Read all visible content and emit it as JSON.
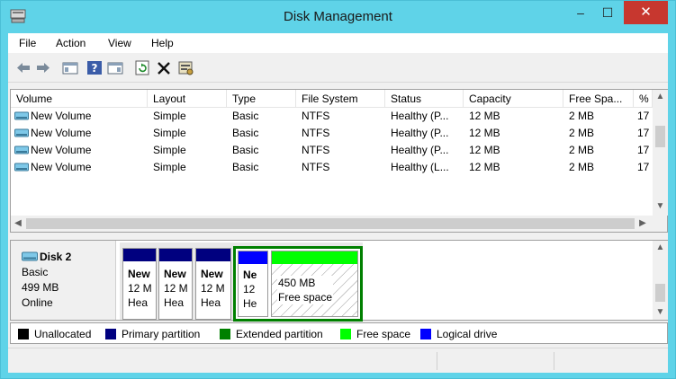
{
  "window": {
    "title": "Disk Management",
    "minimize_glyph": "–",
    "maximize_glyph": "☐",
    "close_glyph": "✕",
    "frame_color": "#5fd3e8",
    "close_color": "#c7372f"
  },
  "menu": {
    "items": [
      "File",
      "Action",
      "View",
      "Help"
    ]
  },
  "toolbar": {
    "icons": [
      "back-arrow-icon",
      "forward-arrow-icon",
      "show-hide-console-tree-icon",
      "help-icon",
      "show-hide-action-pane-icon",
      "refresh-icon",
      "delete-icon",
      "properties-icon"
    ]
  },
  "volume_list": {
    "columns": [
      "Volume",
      "Layout",
      "Type",
      "File System",
      "Status",
      "Capacity",
      "Free Spa...",
      "% "
    ],
    "rows": [
      {
        "volume": "New Volume",
        "layout": "Simple",
        "type": "Basic",
        "fs": "NTFS",
        "status": "Healthy (P...",
        "capacity": "12 MB",
        "free": "2 MB",
        "pct": "17"
      },
      {
        "volume": "New Volume",
        "layout": "Simple",
        "type": "Basic",
        "fs": "NTFS",
        "status": "Healthy (P...",
        "capacity": "12 MB",
        "free": "2 MB",
        "pct": "17"
      },
      {
        "volume": "New Volume",
        "layout": "Simple",
        "type": "Basic",
        "fs": "NTFS",
        "status": "Healthy (P...",
        "capacity": "12 MB",
        "free": "2 MB",
        "pct": "17"
      },
      {
        "volume": "New Volume",
        "layout": "Simple",
        "type": "Basic",
        "fs": "NTFS",
        "status": "Healthy (L...",
        "capacity": "12 MB",
        "free": "2 MB",
        "pct": "17"
      }
    ]
  },
  "disk": {
    "name": "Disk 2",
    "type": "Basic",
    "size": "499 MB",
    "status": "Online",
    "partitions": [
      {
        "line1": "New",
        "line2": "12 M",
        "line3": "Hea",
        "kind": "primary"
      },
      {
        "line1": "New",
        "line2": "12 M",
        "line3": "Hea",
        "kind": "primary"
      },
      {
        "line1": "New",
        "line2": "12 M",
        "line3": "Hea",
        "kind": "primary"
      },
      {
        "line1": "Ne",
        "line2": "12",
        "line3": "He",
        "kind": "logical"
      },
      {
        "line1": "",
        "line2": "450 MB",
        "line3": "Free space",
        "kind": "free"
      }
    ]
  },
  "legend": {
    "items": [
      {
        "label": "Unallocated",
        "color": "#000000"
      },
      {
        "label": "Primary partition",
        "color": "#00007f"
      },
      {
        "label": "Extended partition",
        "color": "#008000"
      },
      {
        "label": "Free space",
        "color": "#00ff00"
      },
      {
        "label": "Logical drive",
        "color": "#0000ff"
      }
    ]
  }
}
